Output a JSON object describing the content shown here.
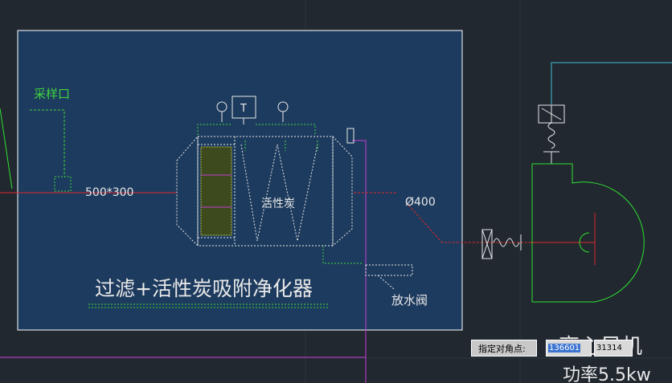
{
  "drawing": {
    "sampling_port": "采样口",
    "duct_size": "500*300",
    "diameter": "Ø400",
    "thermometer_tag": "T",
    "carbon_label": "活性炭",
    "drain_label": "放水阀",
    "title": "过滤+活性炭吸附净化器",
    "fan_label": "离心风机",
    "fan_power": "功率5.5kw"
  },
  "command_prompt": {
    "label": "指定对角点:",
    "x_value": "136601",
    "y_value": "31314"
  },
  "colors": {
    "background": "#212830",
    "selection_fill": "#1d3b5e",
    "linework": "#e8e8e8",
    "green_dashed": "#3fd43f",
    "red_duct": "#e0262b",
    "magenta": "#c23cd0",
    "cyan": "#3fc0d0",
    "fan_green": "#2ee02e"
  }
}
